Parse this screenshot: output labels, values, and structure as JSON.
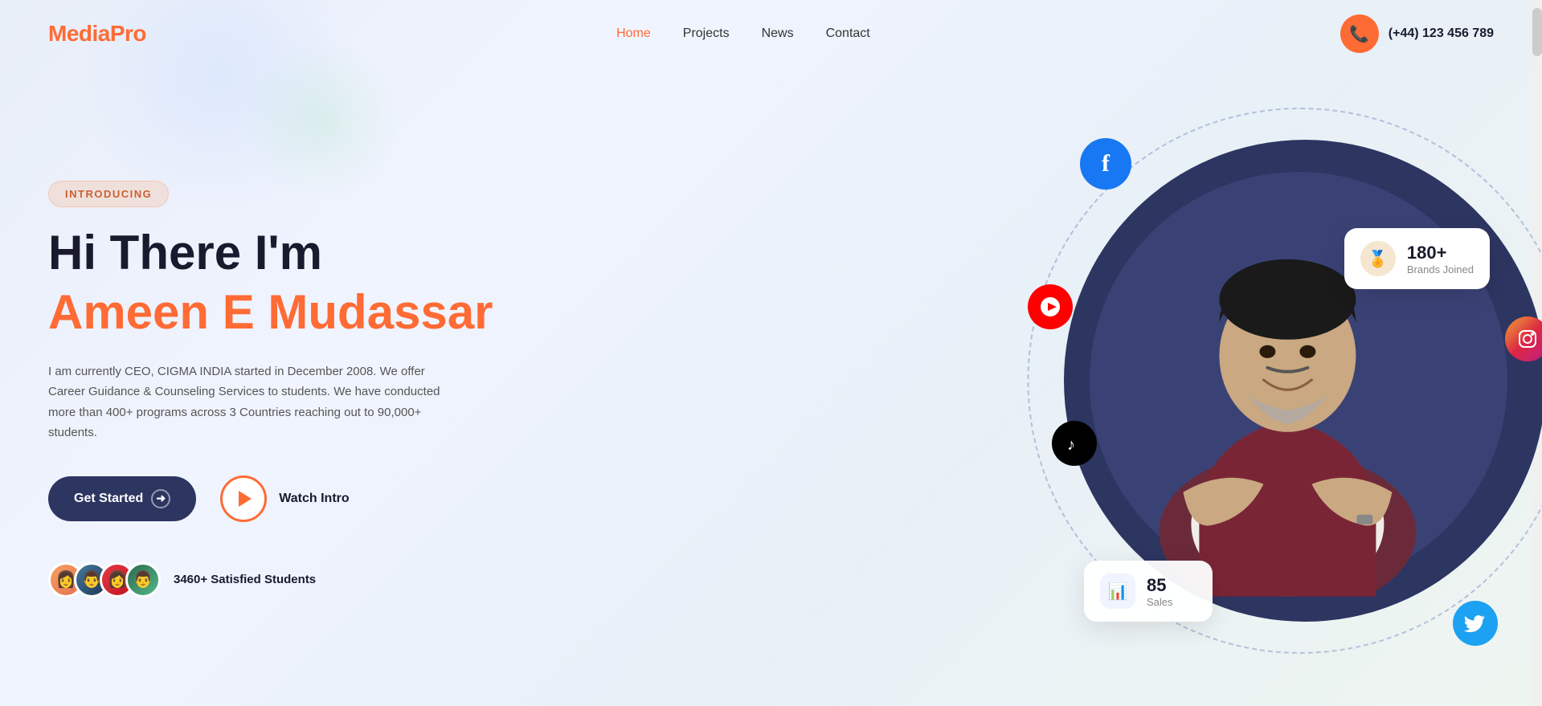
{
  "brand": {
    "name_part1": "Media",
    "name_part2": "Pro"
  },
  "navbar": {
    "links": [
      {
        "label": "Home",
        "active": true
      },
      {
        "label": "Projects",
        "active": false
      },
      {
        "label": "News",
        "active": false
      },
      {
        "label": "Contact",
        "active": false
      }
    ],
    "phone_number": "(+44) 123 456 789"
  },
  "hero": {
    "badge": "INTRODUCING",
    "title_line1": "Hi There I'm",
    "title_name": "Ameen E Mudassar",
    "description": "I am currently CEO, CIGMA INDIA started in December 2008. We offer Career Guidance & Counseling Services to students. We have conducted more than 400+ programs across 3 Countries reaching out to 90,000+ students.",
    "btn_get_started": "Get Started",
    "btn_watch_intro": "Watch Intro",
    "students_count": "3460+ Satisfied Students"
  },
  "stats": {
    "brands": {
      "number": "180+",
      "label": "Brands Joined"
    },
    "sales": {
      "number": "85",
      "label": "Sales"
    }
  },
  "social": {
    "facebook": "f",
    "youtube": "▶",
    "tiktok": "♪",
    "instagram": "📷",
    "twitter": "🐦"
  },
  "colors": {
    "accent": "#ff6b35",
    "dark": "#2d3561",
    "text": "#1a1a2e"
  }
}
